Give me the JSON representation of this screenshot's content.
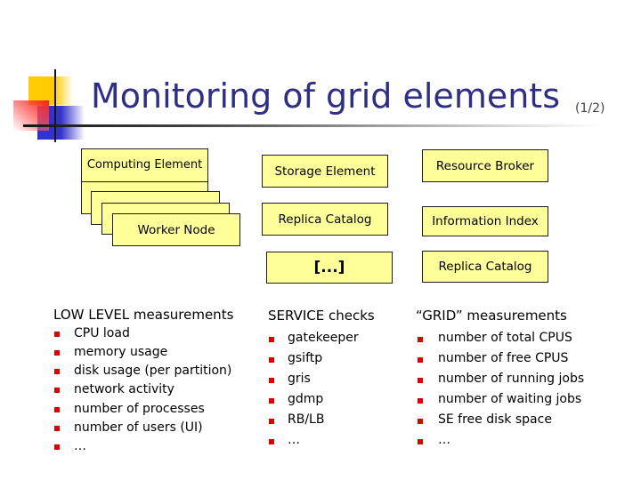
{
  "title": {
    "main": "Monitoring of grid elements",
    "page_indicator": "(1/2)"
  },
  "diagram": {
    "computing_element": {
      "label": "Computing Element",
      "worker_nodes": [
        "Worker Node",
        "Worker Node",
        "Worker Node",
        "Worker Node"
      ]
    },
    "middle_column": [
      {
        "label": "Storage Element"
      },
      {
        "label": "Replica Catalog"
      },
      {
        "label": "[...]"
      }
    ],
    "right_column": [
      {
        "label": "Resource Broker"
      },
      {
        "label": "Information Index"
      },
      {
        "label": "Replica Catalog"
      }
    ]
  },
  "sections": [
    {
      "heading": "LOW LEVEL measurements",
      "items": [
        "CPU load",
        "memory usage",
        "disk usage (per partition)",
        "network activity",
        "number of processes",
        "number of users (UI)",
        "…"
      ]
    },
    {
      "heading": "SERVICE checks",
      "items": [
        "gatekeeper",
        "gsiftp",
        "gris",
        "gdmp",
        "RB/LB",
        "…"
      ]
    },
    {
      "heading": "“GRID” measurements",
      "items": [
        "number of total CPUS",
        "number of free CPUS",
        "number of running jobs",
        "number of waiting jobs",
        "SE free disk space",
        "…"
      ]
    }
  ],
  "colors": {
    "title": "#2e2e84",
    "box_fill": "#ffff99",
    "bullet": "#dd0000",
    "accent_yellow": "#ffcc00",
    "accent_blue": "#3333cc",
    "accent_red": "#ff2020"
  }
}
